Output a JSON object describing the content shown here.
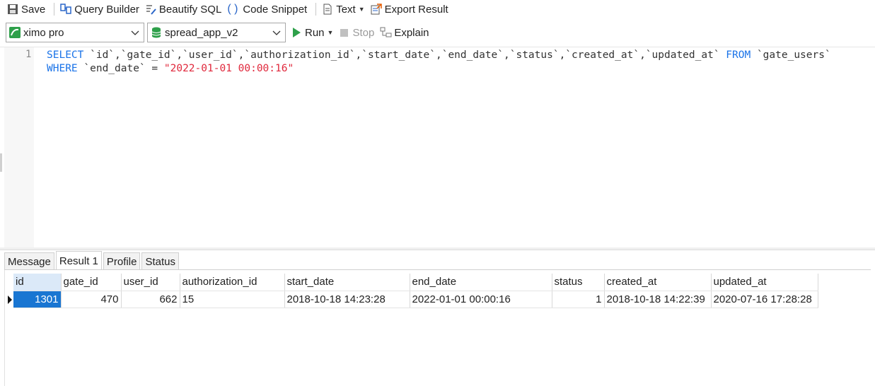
{
  "toolbar": {
    "save": "Save",
    "query_builder": "Query Builder",
    "beautify": "Beautify SQL",
    "snippet": "Code Snippet",
    "text": "Text",
    "export": "Export Result"
  },
  "connection": {
    "name": "ximo pro",
    "database": "spread_app_v2"
  },
  "actions": {
    "run": "Run",
    "stop": "Stop",
    "explain": "Explain"
  },
  "editor": {
    "line_numbers": [
      "1"
    ],
    "line1_kw": "SELECT",
    "line1_cols": " `id`,`gate_id`,`user_id`,`authorization_id`,`start_date`,`end_date`,`status`,`created_at`,`updated_at` ",
    "line1_from": "FROM",
    "line1_table": " `gate_users`",
    "line2_kw": "WHERE",
    "line2_cond": " `end_date` = ",
    "line2_value": "\"2022-01-01 00:00:16\""
  },
  "tabs": [
    "Message",
    "Result 1",
    "Profile",
    "Status"
  ],
  "colors": {
    "keyword": "#1a73e8",
    "string": "#e0283c",
    "selection": "#1976d2",
    "run": "#2ea04a"
  },
  "result": {
    "columns": [
      "id",
      "gate_id",
      "user_id",
      "authorization_id",
      "start_date",
      "end_date",
      "status",
      "created_at",
      "updated_at"
    ],
    "rows": [
      [
        "1301",
        "470",
        "662",
        "15",
        "2018-10-18 14:23:28",
        "2022-01-01 00:00:16",
        "1",
        "2018-10-18 14:22:39",
        "2020-07-16 17:28:28"
      ]
    ]
  }
}
